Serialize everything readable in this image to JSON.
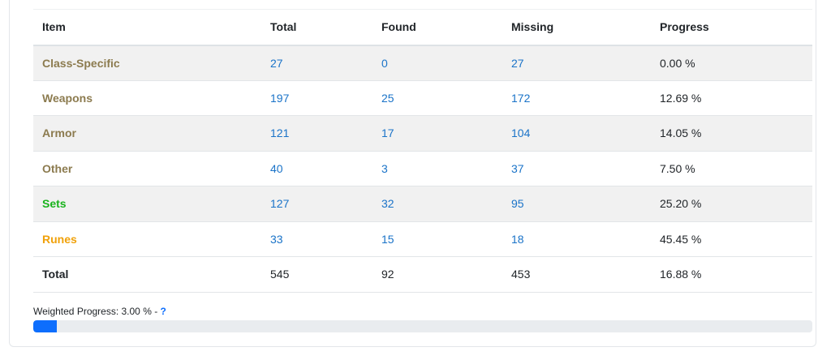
{
  "table": {
    "headers": {
      "item": "Item",
      "total": "Total",
      "found": "Found",
      "missing": "Missing",
      "progress": "Progress"
    },
    "rows": [
      {
        "item": "Class-Specific",
        "total": "27",
        "found": "0",
        "missing": "27",
        "progress": "0.00 %",
        "item_color": "#8c7b4f"
      },
      {
        "item": "Weapons",
        "total": "197",
        "found": "25",
        "missing": "172",
        "progress": "12.69 %",
        "item_color": "#8c7b4f"
      },
      {
        "item": "Armor",
        "total": "121",
        "found": "17",
        "missing": "104",
        "progress": "14.05 %",
        "item_color": "#8c7b4f"
      },
      {
        "item": "Other",
        "total": "40",
        "found": "3",
        "missing": "37",
        "progress": "7.50 %",
        "item_color": "#8c7b4f"
      },
      {
        "item": "Sets",
        "total": "127",
        "found": "32",
        "missing": "95",
        "progress": "25.20 %",
        "item_color": "#19b31c"
      },
      {
        "item": "Runes",
        "total": "33",
        "found": "15",
        "missing": "18",
        "progress": "45.45 %",
        "item_color": "#f0a10a"
      }
    ],
    "total_row": {
      "item": "Total",
      "total": "545",
      "found": "92",
      "missing": "453",
      "progress": "16.88 %"
    }
  },
  "weighted": {
    "label": "Weighted Progress: 3.00 % - ",
    "help": "?",
    "fraction": 0.03
  },
  "colors": {
    "link": "#1a73c8",
    "progress_fill": "#0d6efd",
    "progress_track": "#e9ecef",
    "stripe": "#f1f1f1"
  }
}
